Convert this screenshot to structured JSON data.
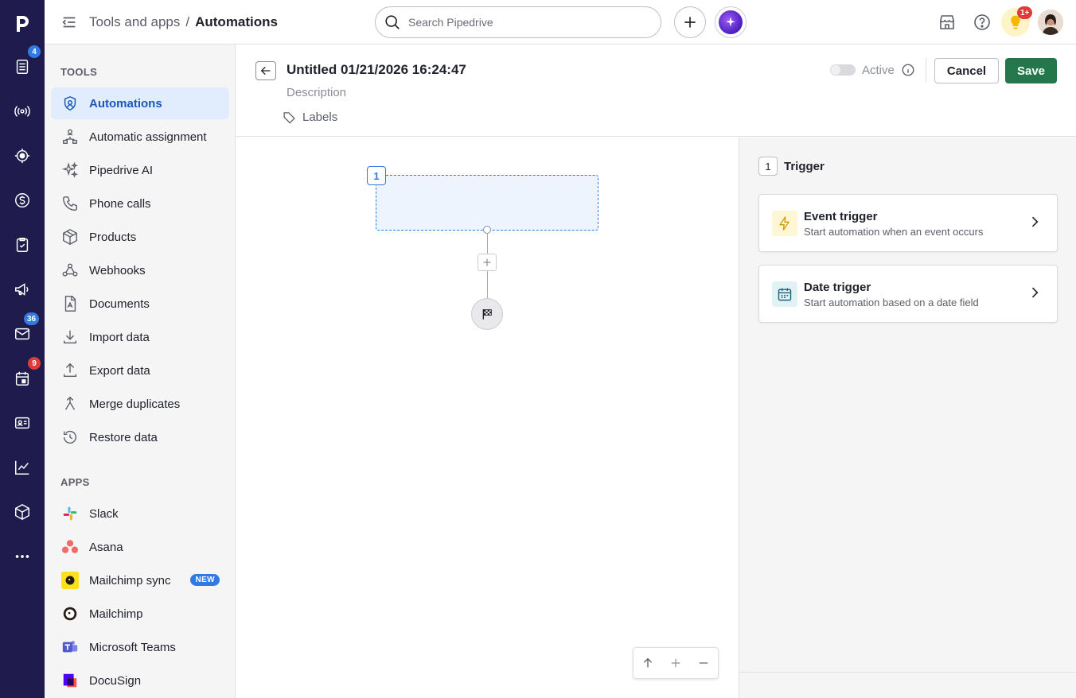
{
  "rail": {
    "items": [
      {
        "name": "leads",
        "badge": "4"
      },
      {
        "name": "campaigns-broadcast"
      },
      {
        "name": "focus"
      },
      {
        "name": "deals"
      },
      {
        "name": "activities"
      },
      {
        "name": "campaigns"
      },
      {
        "name": "mail",
        "badge": "36"
      },
      {
        "name": "calendar",
        "badge": "9"
      },
      {
        "name": "contacts"
      },
      {
        "name": "insights"
      },
      {
        "name": "products"
      },
      {
        "name": "more"
      }
    ],
    "badge_colors": {
      "blue": "#317ae2",
      "red": "#e03b3b"
    },
    "bg_color": "#1f1b4d"
  },
  "topbar": {
    "breadcrumb_parent": "Tools and apps",
    "breadcrumb_sep": "/",
    "breadcrumb_current": "Automations",
    "search_placeholder": "Search Pipedrive",
    "notif_badge": "1+"
  },
  "sidepanel": {
    "tools_heading": "TOOLS",
    "tools": [
      {
        "label": "Automations",
        "icon": "automations-icon",
        "active": true
      },
      {
        "label": "Automatic assignment",
        "icon": "assignment-icon"
      },
      {
        "label": "Pipedrive AI",
        "icon": "sparkle-icon"
      },
      {
        "label": "Phone calls",
        "icon": "phone-icon"
      },
      {
        "label": "Products",
        "icon": "box-icon"
      },
      {
        "label": "Webhooks",
        "icon": "webhook-icon"
      },
      {
        "label": "Documents",
        "icon": "document-icon"
      },
      {
        "label": "Import data",
        "icon": "import-icon"
      },
      {
        "label": "Export data",
        "icon": "export-icon"
      },
      {
        "label": "Merge duplicates",
        "icon": "merge-icon"
      },
      {
        "label": "Restore data",
        "icon": "restore-icon"
      }
    ],
    "apps_heading": "APPS",
    "apps": [
      {
        "label": "Slack",
        "icon": "slack-icon"
      },
      {
        "label": "Asana",
        "icon": "asana-icon"
      },
      {
        "label": "Mailchimp sync",
        "icon": "mailchimp-icon",
        "pill": "NEW"
      },
      {
        "label": "Mailchimp",
        "icon": "mailchimp-icon"
      },
      {
        "label": "Microsoft Teams",
        "icon": "teams-icon"
      },
      {
        "label": "DocuSign",
        "icon": "docusign-icon"
      }
    ],
    "active_color": "#1958b6"
  },
  "editor": {
    "title": "Untitled 01/21/2026 16:24:47",
    "description_placeholder": "Description",
    "labels": "Labels",
    "active_label": "Active",
    "active": false,
    "cancel": "Cancel",
    "save": "Save",
    "save_color": "#24774a"
  },
  "canvas": {
    "step_number": "1"
  },
  "trigger_panel": {
    "step_number": "1",
    "title": "Trigger",
    "options": [
      {
        "title": "Event trigger",
        "subtitle": "Start automation when an event occurs",
        "icon": "lightning-icon"
      },
      {
        "title": "Date trigger",
        "subtitle": "Start automation based on a date field",
        "icon": "calendar-icon"
      }
    ]
  }
}
